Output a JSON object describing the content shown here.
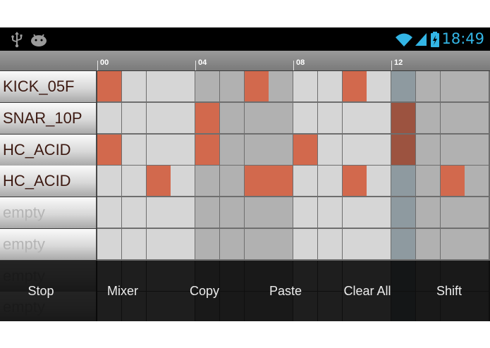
{
  "status": {
    "time": "18:49",
    "left_icons": [
      "usb-icon",
      "android-debug-icon"
    ],
    "right_icons": [
      "wifi-icon",
      "signal-icon",
      "battery-charging-icon"
    ],
    "accent": "#33b5e5"
  },
  "ruler": {
    "labels": [
      "00",
      "04",
      "08",
      "12"
    ]
  },
  "tracks": [
    {
      "name": "KICK_05F",
      "steps": [
        1,
        0,
        0,
        0,
        0,
        0,
        1,
        0,
        0,
        0,
        1,
        0,
        0,
        0,
        0,
        0
      ]
    },
    {
      "name": "SNAR_10P",
      "steps": [
        0,
        0,
        0,
        0,
        1,
        0,
        0,
        0,
        0,
        0,
        0,
        0,
        1,
        0,
        0,
        0
      ]
    },
    {
      "name": "HC_ACID",
      "steps": [
        1,
        0,
        0,
        0,
        1,
        0,
        0,
        0,
        1,
        0,
        0,
        0,
        1,
        0,
        0,
        0
      ]
    },
    {
      "name": "HC_ACID",
      "steps": [
        0,
        0,
        1,
        0,
        0,
        0,
        1,
        1,
        0,
        0,
        1,
        0,
        0,
        0,
        1,
        0
      ]
    },
    {
      "name": "empty",
      "steps": [
        0,
        0,
        0,
        0,
        0,
        0,
        0,
        0,
        0,
        0,
        0,
        0,
        0,
        0,
        0,
        0
      ]
    },
    {
      "name": "empty",
      "steps": [
        0,
        0,
        0,
        0,
        0,
        0,
        0,
        0,
        0,
        0,
        0,
        0,
        0,
        0,
        0,
        0
      ]
    },
    {
      "name": "empty",
      "steps": [
        0,
        0,
        0,
        0,
        0,
        0,
        0,
        0,
        0,
        0,
        0,
        0,
        0,
        0,
        0,
        0
      ]
    },
    {
      "name": "empty",
      "steps": [
        0,
        0,
        0,
        0,
        0,
        0,
        0,
        0,
        0,
        0,
        0,
        0,
        0,
        0,
        0,
        0
      ]
    }
  ],
  "playhead_step": 12,
  "toolbar": {
    "buttons": [
      "Stop",
      "Mixer",
      "Copy",
      "Paste",
      "Clear All",
      "Shift"
    ]
  },
  "colors": {
    "step_on": "#d2694d",
    "step_on_playhead": "#9c5340",
    "cell_light": "#d6d6d6",
    "cell_dark": "#b1b1b1",
    "playhead_column": "#8e9aa0",
    "grid_line": "#6e6e6e"
  }
}
